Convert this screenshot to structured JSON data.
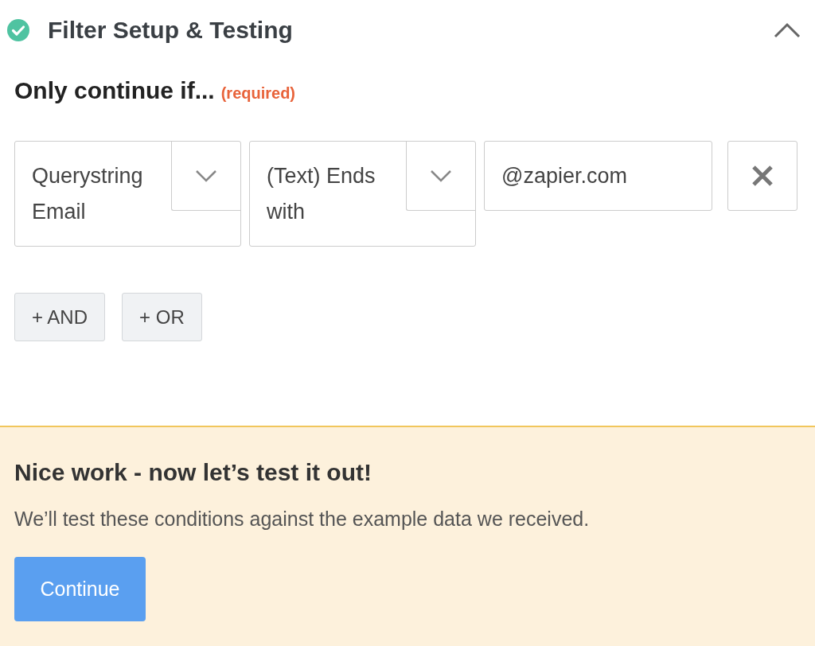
{
  "section": {
    "title": "Filter Setup & Testing",
    "completed": true,
    "expanded": true
  },
  "filter": {
    "heading": "Only continue if...",
    "required_label": "(required)",
    "conditions": [
      {
        "field": "Querystring Email",
        "operator": "(Text) Ends with",
        "value": "@zapier.com"
      }
    ],
    "buttons": [
      "+ AND",
      "+ OR"
    ]
  },
  "notice": {
    "title": "Nice work - now let’s test it out!",
    "text": "We’ll test these conditions against the example data we received.",
    "button": "Continue"
  }
}
